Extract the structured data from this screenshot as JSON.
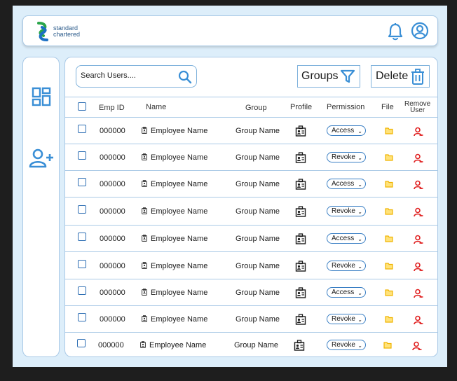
{
  "brand": {
    "line1": "standard",
    "line2": "chartered"
  },
  "header": {
    "notifications_icon": "bell-icon",
    "profile_icon": "user-circle-icon"
  },
  "sidebar": {
    "items": [
      {
        "icon": "dashboard-icon"
      },
      {
        "icon": "add-user-icon"
      }
    ]
  },
  "toolbar": {
    "search_placeholder": "Search Users....",
    "groups_label": "Groups",
    "delete_label": "Delete"
  },
  "table": {
    "columns": {
      "emp_id": "Emp ID",
      "name": "Name",
      "group": "Group",
      "profile": "Profile",
      "permission": "Permission",
      "file": "File",
      "remove_line1": "Remove",
      "remove_line2": "User"
    },
    "rows": [
      {
        "emp_id": "000000",
        "name": "Employee Name",
        "group": "Group Name",
        "permission": "Access"
      },
      {
        "emp_id": "000000",
        "name": "Employee Name",
        "group": "Group Name",
        "permission": "Revoke"
      },
      {
        "emp_id": "000000",
        "name": "Employee Name",
        "group": "Group Name",
        "permission": "Access"
      },
      {
        "emp_id": "000000",
        "name": "Employee Name",
        "group": "Group Name",
        "permission": "Revoke"
      },
      {
        "emp_id": "000000",
        "name": "Employee Name",
        "group": "Group Name",
        "permission": "Access"
      },
      {
        "emp_id": "000000",
        "name": "Employee Name",
        "group": "Group Name",
        "permission": "Revoke"
      },
      {
        "emp_id": "000000",
        "name": "Employee Name",
        "group": "Group Name",
        "permission": "Access"
      },
      {
        "emp_id": "000000",
        "name": "Employee Name",
        "group": "Group Name",
        "permission": "Revoke"
      },
      {
        "emp_id": "000000",
        "name": "Employee Name",
        "group": "Group Name",
        "permission": "Revoke"
      }
    ]
  },
  "colors": {
    "accent": "#3a8fd6",
    "remove": "#e02020",
    "file": "#f0b400",
    "frame": "#ddeefa",
    "border": "#a9c9e6"
  }
}
